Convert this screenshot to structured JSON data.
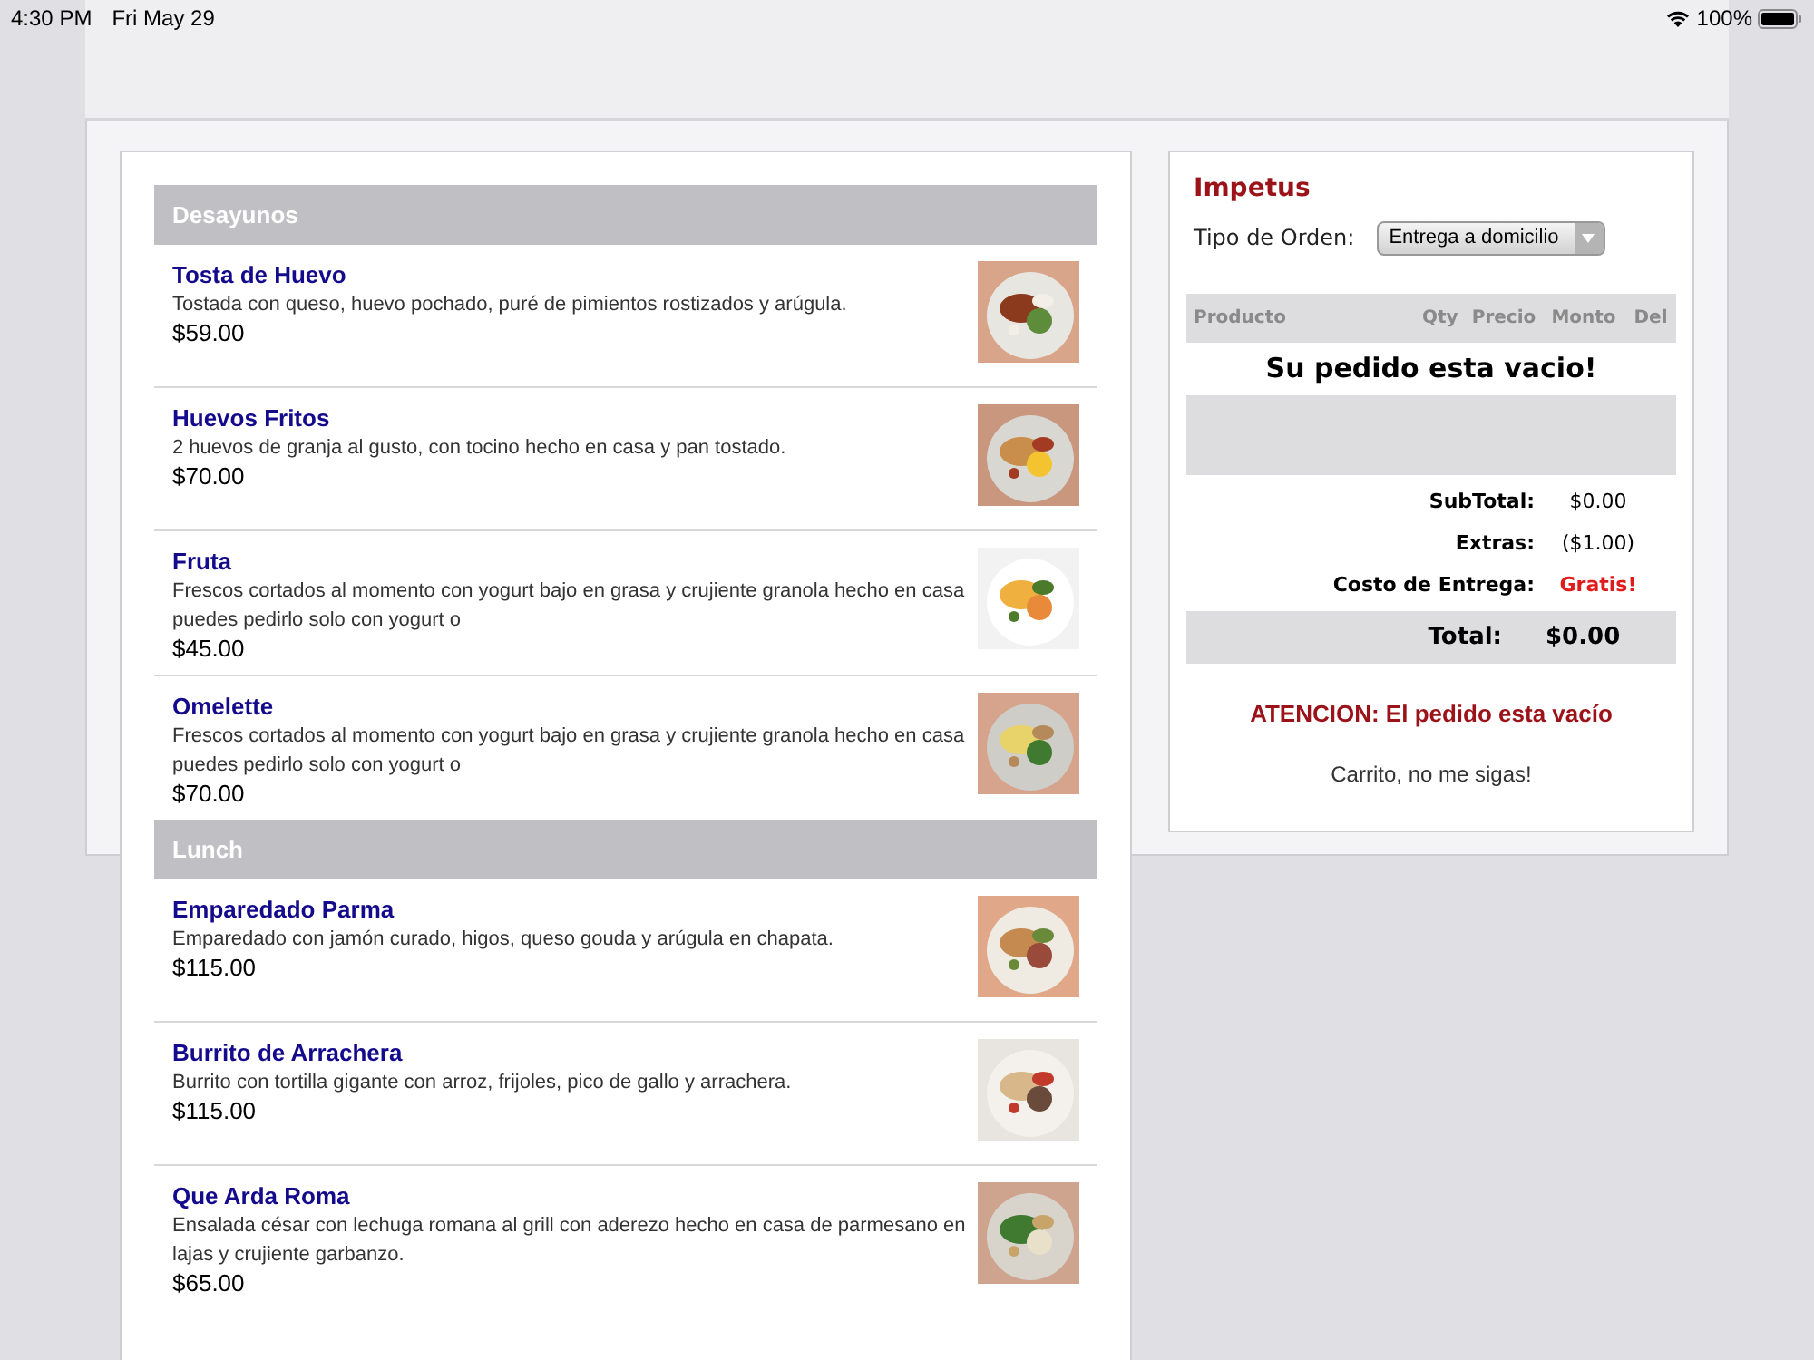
{
  "status_bar": {
    "time": "4:30 PM",
    "date": "Fri May 29",
    "battery": "100%"
  },
  "menu": {
    "sections": [
      {
        "title": "Desayunos",
        "items": [
          {
            "name": "Tosta de Huevo",
            "description": "Tostada con queso, huevo pochado, puré de pimientos rostizados y arúgula.",
            "price": "$59.00"
          },
          {
            "name": "Huevos Fritos",
            "description": "2 huevos de granja al gusto, con tocino hecho en casa y pan tostado.",
            "price": "$70.00"
          },
          {
            "name": "Fruta",
            "description": "Frescos cortados al momento con yogurt bajo en grasa y crujiente granola hecho en casa puedes pedirlo solo con yogurt o",
            "price": "$45.00"
          },
          {
            "name": "Omelette",
            "description": "Frescos cortados al momento con yogurt bajo en grasa y crujiente granola hecho en casa puedes pedirlo solo con yogurt o",
            "price": "$70.00"
          }
        ]
      },
      {
        "title": "Lunch",
        "items": [
          {
            "name": "Emparedado Parma",
            "description": "Emparedado con jamón curado, higos, queso gouda y arúgula en chapata.",
            "price": "$115.00"
          },
          {
            "name": "Burrito de Arrachera",
            "description": "Burrito con tortilla gigante con arroz, frijoles, pico de gallo y arrachera.",
            "price": "$115.00"
          },
          {
            "name": "Que Arda Roma",
            "description": "Ensalada césar con lechuga romana al grill con aderezo hecho en casa de parmesano en lajas y crujiente garbanzo.",
            "price": "$65.00"
          }
        ]
      }
    ]
  },
  "cart": {
    "title": "Impetus",
    "order_type_label": "Tipo de Orden:",
    "order_type_value": "Entrega a domicilio",
    "columns": [
      "Producto",
      "Qty",
      "Precio",
      "Monto",
      "Del"
    ],
    "empty_message": "Su pedido esta vacio!",
    "totals": [
      {
        "label": "SubTotal:",
        "value": "$0.00",
        "kind": "normal"
      },
      {
        "label": "Extras:",
        "value": "($1.00)",
        "kind": "normal"
      },
      {
        "label": "Costo de Entrega:",
        "value": "Gratis!",
        "kind": "highlight"
      }
    ],
    "total": {
      "label": "Total:",
      "value": "$0.00"
    },
    "warning": "ATENCION: El pedido esta vacío",
    "footer": "Carrito, no me sigas!"
  }
}
